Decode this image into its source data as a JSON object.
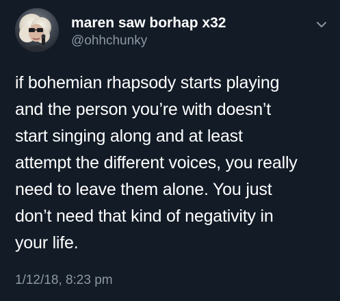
{
  "colors": {
    "background": "#121b26",
    "text_primary": "#ffffff",
    "text_secondary": "#8b98a5"
  },
  "tweet": {
    "author": {
      "display_name": "maren saw borhap x32",
      "handle": "@ohhchunky",
      "avatar_icon": "profile-photo"
    },
    "menu_icon": "chevron-down-icon",
    "text_lines": [
      "if bohemian rhapsody starts playing",
      "and the person you’re with doesn’t",
      "start singing along and at least",
      "attempt the different voices, you really",
      "need to leave them alone. You just",
      "don’t need that kind of negativity in",
      "your life."
    ],
    "timestamp": "1/12/18, 8:23 pm"
  }
}
